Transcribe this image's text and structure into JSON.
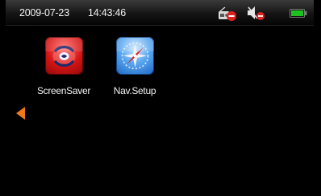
{
  "statusbar": {
    "date": "2009-07-23",
    "time": "14:43:46",
    "icons": [
      "radio-off-icon",
      "mute-icon",
      "battery-icon"
    ],
    "battery_color": "#1ec21e"
  },
  "apps": [
    {
      "label": "ScreenSaver",
      "icon": "screensaver-icon",
      "color": "#d41414"
    },
    {
      "label": "Nav.Setup",
      "icon": "compass-icon",
      "color": "#3a8be0"
    }
  ],
  "navigation": {
    "left_arrow": "arrow-left-icon",
    "arrow_color": "#f07a1a"
  }
}
